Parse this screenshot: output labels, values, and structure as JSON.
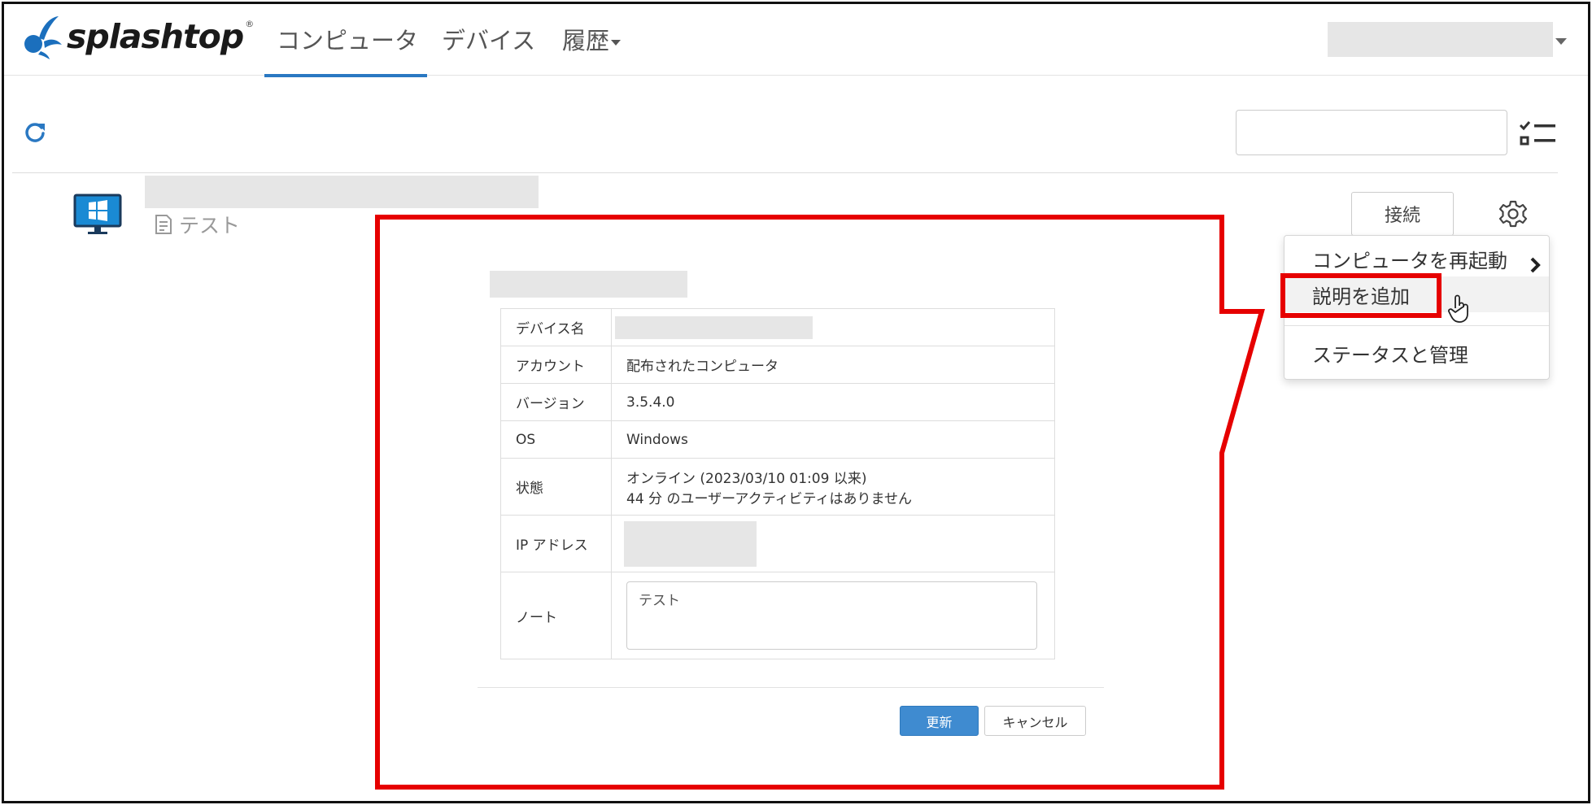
{
  "header": {
    "logo_text": "splashtop",
    "logo_reg": "®",
    "tabs": [
      {
        "label": "コンピュータ"
      },
      {
        "label": "デバイス"
      },
      {
        "label": "履歴"
      }
    ]
  },
  "computer": {
    "note": "テスト",
    "connect_label": "接続"
  },
  "menu": {
    "items": [
      {
        "label": "コンピュータを再起動"
      },
      {
        "label": "説明を追加"
      },
      {
        "label": "ステータスと管理"
      }
    ]
  },
  "detail": {
    "rows": [
      {
        "key": "デバイス名",
        "value": ""
      },
      {
        "key": "アカウント",
        "value": "配布されたコンピュータ"
      },
      {
        "key": "バージョン",
        "value": "3.5.4.0"
      },
      {
        "key": "OS",
        "value": "Windows"
      },
      {
        "key": "状態",
        "value": "オンライン (2023/03/10 01:09 以来)",
        "value2": "44 分 のユーザーアクティビティはありません"
      },
      {
        "key": "IP アドレス",
        "value": ""
      },
      {
        "key": "ノート",
        "value": "テスト"
      }
    ],
    "update_label": "更新",
    "cancel_label": "キャンセル"
  },
  "colors": {
    "accent": "#2a78c2",
    "highlight": "#e60000",
    "primary_button": "#3f8bd0"
  }
}
